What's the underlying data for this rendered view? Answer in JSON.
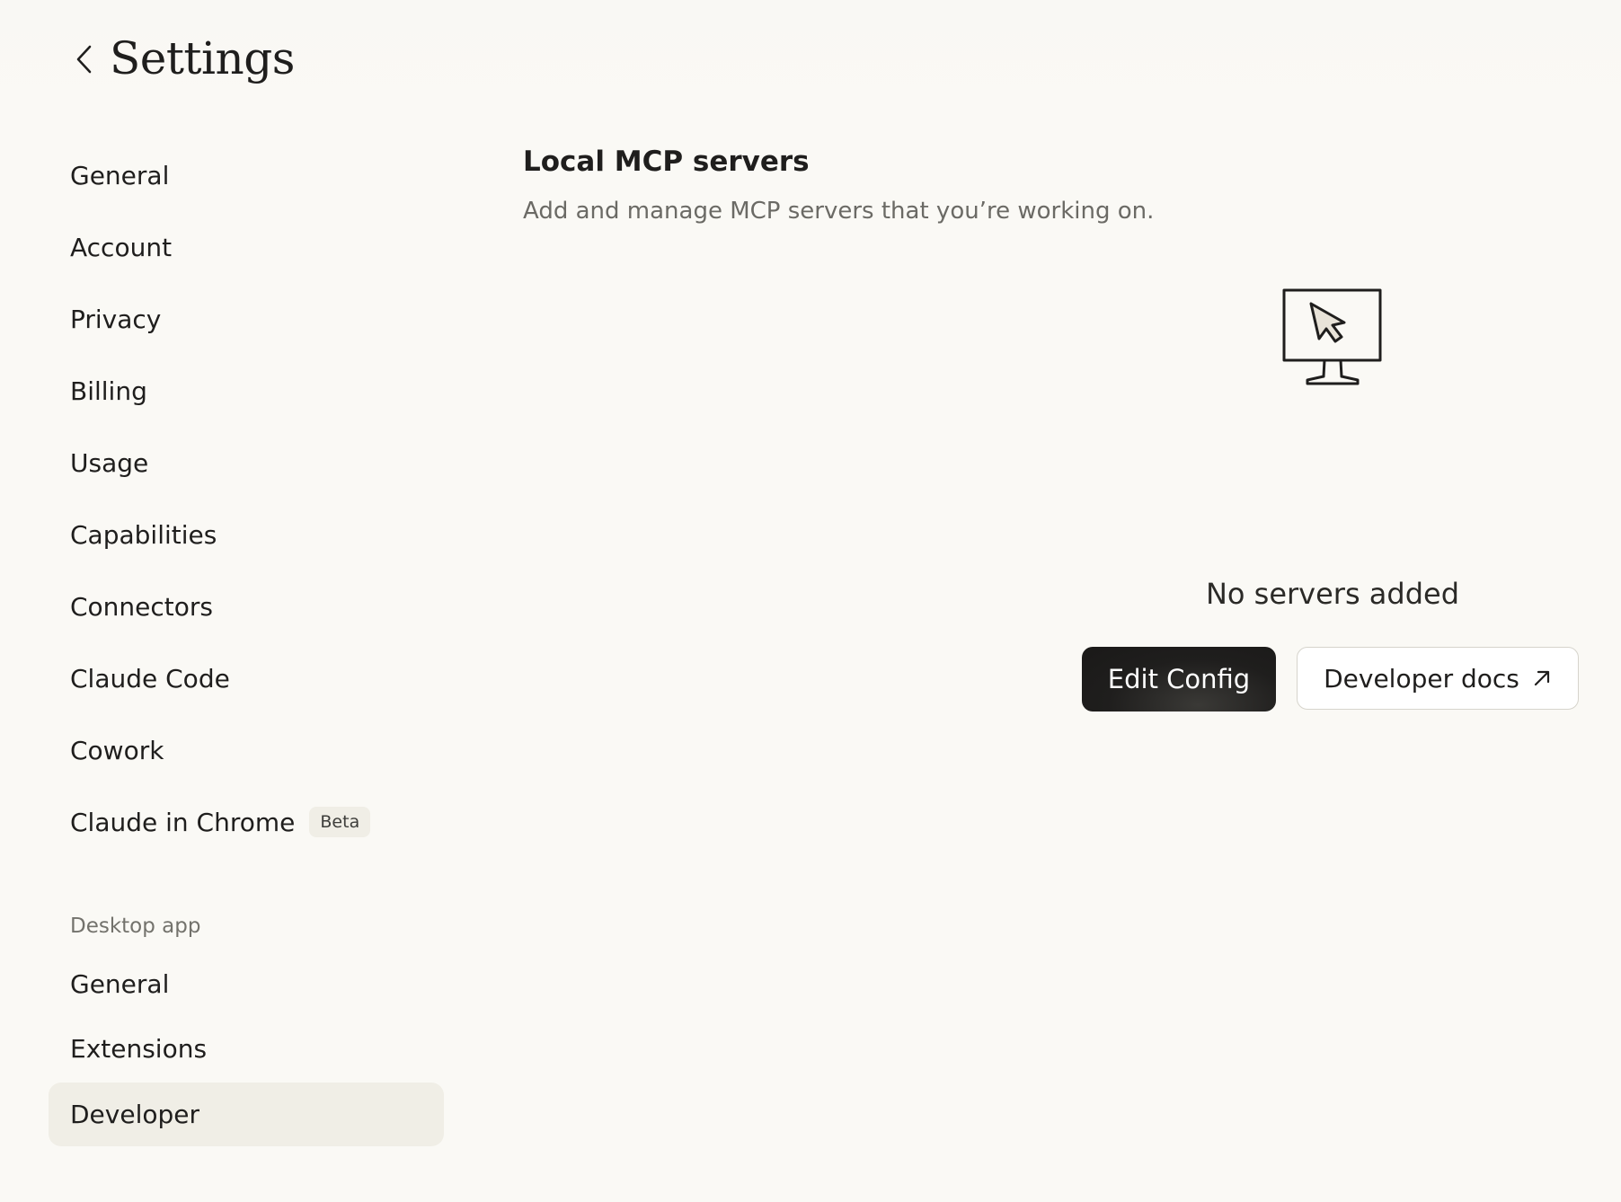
{
  "header": {
    "title": "Settings",
    "back_icon": "chevron-left-icon"
  },
  "sidebar": {
    "items": [
      {
        "label": "General"
      },
      {
        "label": "Account"
      },
      {
        "label": "Privacy"
      },
      {
        "label": "Billing"
      },
      {
        "label": "Usage"
      },
      {
        "label": "Capabilities"
      },
      {
        "label": "Connectors"
      },
      {
        "label": "Claude Code"
      },
      {
        "label": "Cowork"
      },
      {
        "label": "Claude in Chrome",
        "badge": "Beta"
      }
    ],
    "desktop_section": {
      "label": "Desktop app",
      "items": [
        {
          "label": "General"
        },
        {
          "label": "Extensions"
        },
        {
          "label": "Developer",
          "active": true
        }
      ]
    }
  },
  "main": {
    "title": "Local MCP servers",
    "subtitle": "Add and manage MCP servers that you’re working on.",
    "empty_state": {
      "icon": "monitor-cursor-icon",
      "text": "No servers added",
      "edit_button": "Edit Config",
      "docs_button": "Developer docs",
      "docs_icon": "arrow-up-right-icon"
    }
  },
  "colors": {
    "background": "#faf9f5",
    "active_item": "#f0eee6",
    "primary_button": "#1f1e1d",
    "text_muted": "#73726c"
  }
}
